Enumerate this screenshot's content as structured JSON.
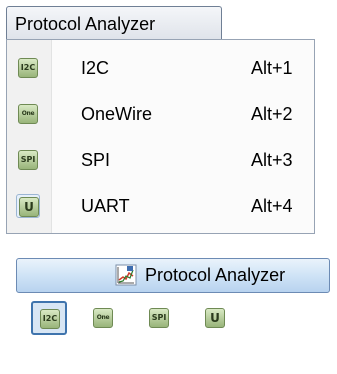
{
  "menu": {
    "title": "Protocol Analyzer",
    "items": [
      {
        "icon_text": "I2C",
        "label": "I2C",
        "shortcut": "Alt+1",
        "checked": false
      },
      {
        "icon_text": "One",
        "label": "OneWire",
        "shortcut": "Alt+2",
        "checked": false
      },
      {
        "icon_text": "SPI",
        "label": "SPI",
        "shortcut": "Alt+3",
        "checked": false
      },
      {
        "icon_text": "U",
        "label": "UART",
        "shortcut": "Alt+4",
        "checked": true
      }
    ]
  },
  "ribbon": {
    "button_label": "Protocol Analyzer",
    "button_icon": "chart-analyzer-icon",
    "tools": [
      {
        "icon_text": "I2C",
        "selected": true
      },
      {
        "icon_text": "One",
        "selected": false
      },
      {
        "icon_text": "SPI",
        "selected": false
      },
      {
        "icon_text": "U",
        "selected": false
      }
    ]
  },
  "colors": {
    "icon_green": "#98b47a",
    "ribbon_blue": "#cfe3f6",
    "selection_border": "#3f74ad"
  }
}
